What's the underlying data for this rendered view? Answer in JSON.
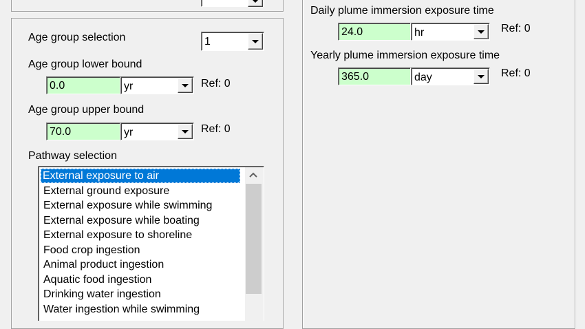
{
  "left_panel": {
    "age_group_selection_label": "Age group selection",
    "age_group_selection_value": "1",
    "lower_bound_label": "Age group lower bound",
    "lower_bound_value": "0.0",
    "lower_bound_unit": "yr",
    "lower_bound_ref": "Ref:  0",
    "upper_bound_label": "Age group upper bound",
    "upper_bound_value": "70.0",
    "upper_bound_unit": "yr",
    "upper_bound_ref": "Ref:  0",
    "pathway_label": "Pathway selection",
    "pathways": [
      "External exposure to air",
      "External ground exposure",
      "External exposure while swimming",
      "External exposure while boating",
      "External exposure to shoreline",
      "Food crop ingestion",
      "Animal product ingestion",
      "Aquatic food ingestion",
      "Drinking water ingestion",
      "Water ingestion while swimming"
    ],
    "selected_pathway_index": 0
  },
  "right_panel": {
    "daily_label": "Daily plume immersion exposure time",
    "daily_value": "24.0",
    "daily_unit": "hr",
    "daily_ref": "Ref:  0",
    "yearly_label": "Yearly plume immersion exposure time",
    "yearly_value": "365.0",
    "yearly_unit": "day",
    "yearly_ref": "Ref:  0"
  },
  "colors": {
    "input_bg": "#ccffcc",
    "selection": "#0078d7",
    "window_bg": "#f0f0f0"
  },
  "icons": {
    "dropdown": "chevron-down-icon",
    "scroll_up": "chevron-up-icon"
  }
}
